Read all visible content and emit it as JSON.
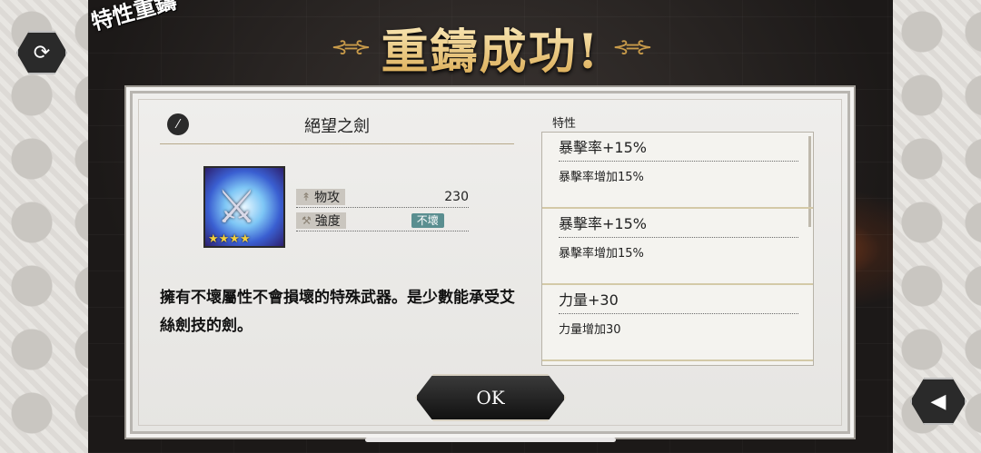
{
  "screen": {
    "tag": "特性重鑄",
    "title": "重鑄成功!"
  },
  "item": {
    "name": "絕望之劍",
    "stars": "★★★★",
    "stats": [
      {
        "label": "物攻",
        "value": "230"
      },
      {
        "label": "強度",
        "badge": "不壞"
      }
    ],
    "description": "擁有不壞屬性不會損壞的特殊武器。是少數能承受艾絲劍技的劍。"
  },
  "traits": {
    "label": "特性",
    "items": [
      {
        "name": "暴擊率+15%",
        "desc": "暴擊率增加15%"
      },
      {
        "name": "暴擊率+15%",
        "desc": "暴擊率增加15%"
      },
      {
        "name": "力量+30",
        "desc": "力量增加30"
      }
    ]
  },
  "buttons": {
    "ok": "OK",
    "refresh_icon": "refresh-icon",
    "speaker_icon": "speaker-icon"
  },
  "colors": {
    "title_gold": "#f2d89a",
    "badge": "#5a8e90",
    "panel": "#efeeec"
  }
}
